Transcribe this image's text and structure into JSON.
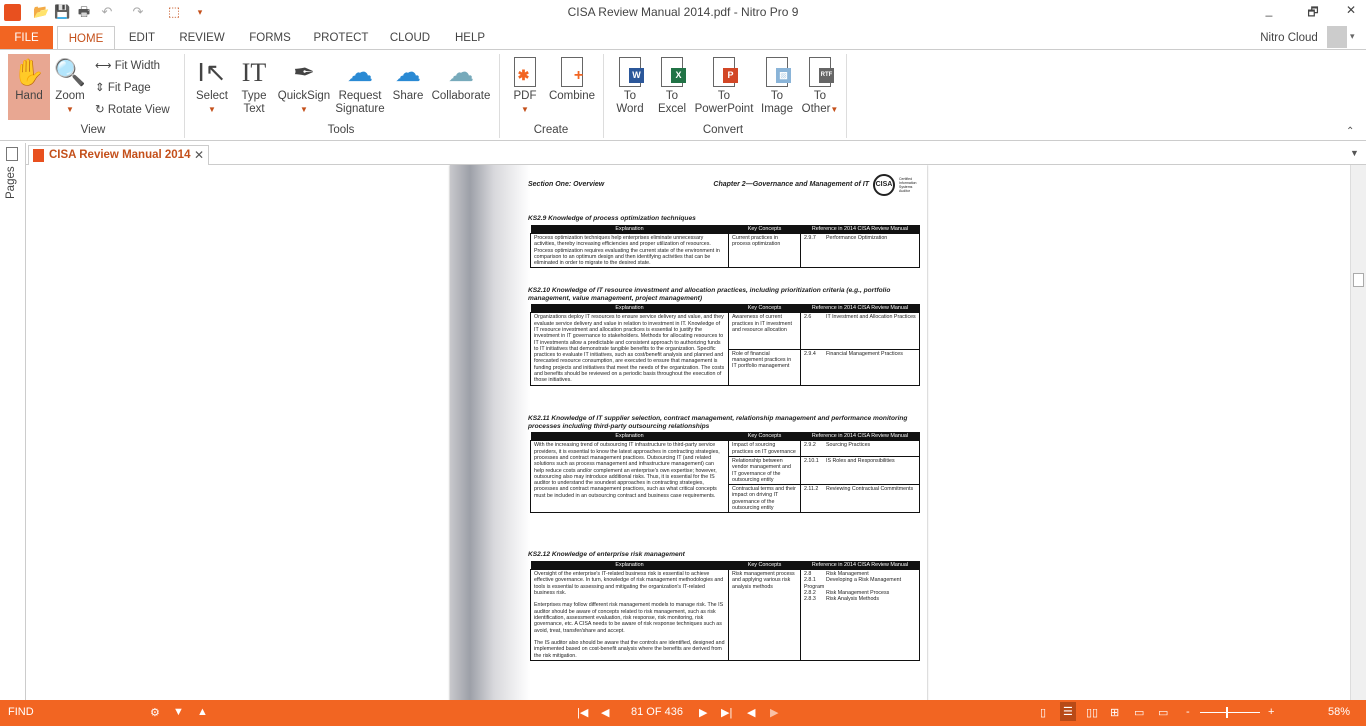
{
  "window": {
    "title": "CISA Review Manual 2014.pdf - Nitro Pro 9",
    "minimize": "_",
    "restore": "🗗",
    "close": "✕"
  },
  "quick_access": [
    "open-icon",
    "save-icon",
    "print-icon",
    "undo-icon",
    "redo-icon",
    "select-cursor-icon",
    "customize-icon"
  ],
  "tabs": [
    "FILE",
    "HOME",
    "EDIT",
    "REVIEW",
    "FORMS",
    "PROTECT",
    "CLOUD",
    "HELP"
  ],
  "account": {
    "label": "Nitro Cloud"
  },
  "ribbon": {
    "view": {
      "label": "View",
      "hand": "Hand",
      "zoom": "Zoom",
      "fit_width": "Fit Width",
      "fit_page": "Fit Page",
      "rotate_view": "Rotate View"
    },
    "tools": {
      "label": "Tools",
      "select": "Select",
      "type_text_1": "Type",
      "type_text_2": "Text",
      "quicksign": "QuickSign",
      "request_1": "Request",
      "request_2": "Signature",
      "share": "Share",
      "collaborate": "Collaborate"
    },
    "create": {
      "label": "Create",
      "pdf": "PDF",
      "combine": "Combine"
    },
    "convert": {
      "label": "Convert",
      "word": [
        "To",
        "Word"
      ],
      "excel": [
        "To",
        "Excel"
      ],
      "ppt": [
        "To",
        "PowerPoint"
      ],
      "image": [
        "To",
        "Image"
      ],
      "other": [
        "To",
        "Other"
      ]
    }
  },
  "doc_tab": {
    "title": "CISA Review Manual 2014"
  },
  "sidebar": {
    "pages": "Pages"
  },
  "page": {
    "header_left": "Section One:  Overview",
    "header_right": "Chapter 2—Governance and Management of IT",
    "logo": "CISA Certified Information Systems Auditor",
    "col_expl": "Explanation",
    "col_key": "Key Concepts",
    "col_ref": "Reference in 2014 CISA Review Manual",
    "sections": [
      {
        "heading": "KS2.9 Knowledge of process optimization techniques",
        "explanation": "Process optimization techniques help enterprises eliminate unnecessary activities, thereby increasing efficiencies and proper utilization of resources. Process optimization requires evaluating the current state of the environment in comparison to an optimum design and then identifying activities that can be eliminated in order to migrate to the desired state.",
        "rows": [
          {
            "key": "Current practices in process optimization",
            "refs": [
              [
                "2.9.7",
                "Performance Optimization"
              ]
            ]
          }
        ]
      },
      {
        "heading": "KS2.10 Knowledge of IT resource investment and allocation practices, including prioritization criteria (e.g., portfolio management, value management, project management)",
        "explanation": "Organizations deploy IT resources to ensure service delivery and value, and they evaluate service delivery and value in relation to investment in IT. Knowledge of IT resource investment and allocation practices is essential to justify the investment in IT governance to stakeholders. Methods for allocating resources to IT investments allow a predictable and consistent approach to authorizing funds to IT initiatives that demonstrate tangible benefits to the organization. Specific practices to evaluate IT initiatives, such as cost/benefit analysis and planned and forecasted resource consumption, are executed to ensure that management is funding projects and initiatives that meet the needs of the organization. The costs and benefits should be reviewed on a periodic basis throughout the execution of those initiatives.",
        "rows": [
          {
            "key": "Awareness of current practices in IT investment and resource allocation",
            "refs": [
              [
                "2.6",
                "IT Investment and Allocation Practices"
              ]
            ]
          },
          {
            "key": "Role of financial management practices in IT portfolio management",
            "refs": [
              [
                "2.9.4",
                "Financial Management Practices"
              ]
            ]
          }
        ]
      },
      {
        "heading": "KS2.11 Knowledge of IT supplier selection, contract management, relationship management and performance monitoring processes including third-party outsourcing relationships",
        "explanation": "With the increasing trend of outsourcing IT infrastructure to third-party service providers, it is essential to know the latest approaches in contracting strategies, processes and contract management practices. Outsourcing IT (and related solutions such as process management and infrastructure management) can help reduce costs and/or complement an enterprise's own expertise; however, outsourcing also may introduce additional risks. Thus, it is essential for the IS auditor to understand the soundest approaches in contracting strategies, processes and contract management practices, such as what critical concepts must be included in an outsourcing contract and business case requirements.",
        "rows": [
          {
            "key": "Impact of sourcing practices on IT governance",
            "refs": [
              [
                "2.9.2",
                "Sourcing Practices"
              ]
            ]
          },
          {
            "key": "Relationship between vendor management and IT governance of the outsourcing entity",
            "refs": [
              [
                "2.10.1",
                "IS Roles and Responsibilities"
              ]
            ]
          },
          {
            "key": "Contractual terms and their impact on driving IT governance of the outsourcing entity",
            "refs": [
              [
                "2.11.2",
                "Reviewing Contractual Commitments"
              ]
            ]
          }
        ]
      },
      {
        "heading": "KS2.12 Knowledge of enterprise risk management",
        "explanation": "Oversight of the enterprise's IT-related business risk is essential to achieve effective governance. In turn, knowledge of risk management methodologies and tools is essential to assessing and mitigating the organization's IT-related business risk.\n\nEnterprises may follow different risk management models to manage risk. The IS auditor should be aware of concepts related to risk management, such as risk identification, assessment evaluation, risk response, risk monitoring, risk governance, etc. A CISA needs to be aware of risk response techniques such as avoid, treat, transfer/share and accept.\n\nThe IS auditor also should be aware that the controls are identified, designed and implemented based on cost-benefit analysis where the benefits are derived from the risk mitigation.",
        "rows": [
          {
            "key": "Risk management process and applying various risk analysis methods",
            "refs": [
              [
                "2.8",
                "Risk Management"
              ],
              [
                "2.8.1",
                "Developing a Risk Management Program"
              ],
              [
                "2.8.2",
                "Risk Management Process"
              ],
              [
                "2.8.3",
                "Risk Analysis Methods"
              ]
            ]
          }
        ]
      }
    ]
  },
  "status": {
    "find": "FIND",
    "page_indicator": "81 OF 436",
    "zoom": "58%",
    "zoom_level_percent": 58,
    "active_view": "continuous",
    "colors": {
      "accent": "#f26522"
    }
  }
}
